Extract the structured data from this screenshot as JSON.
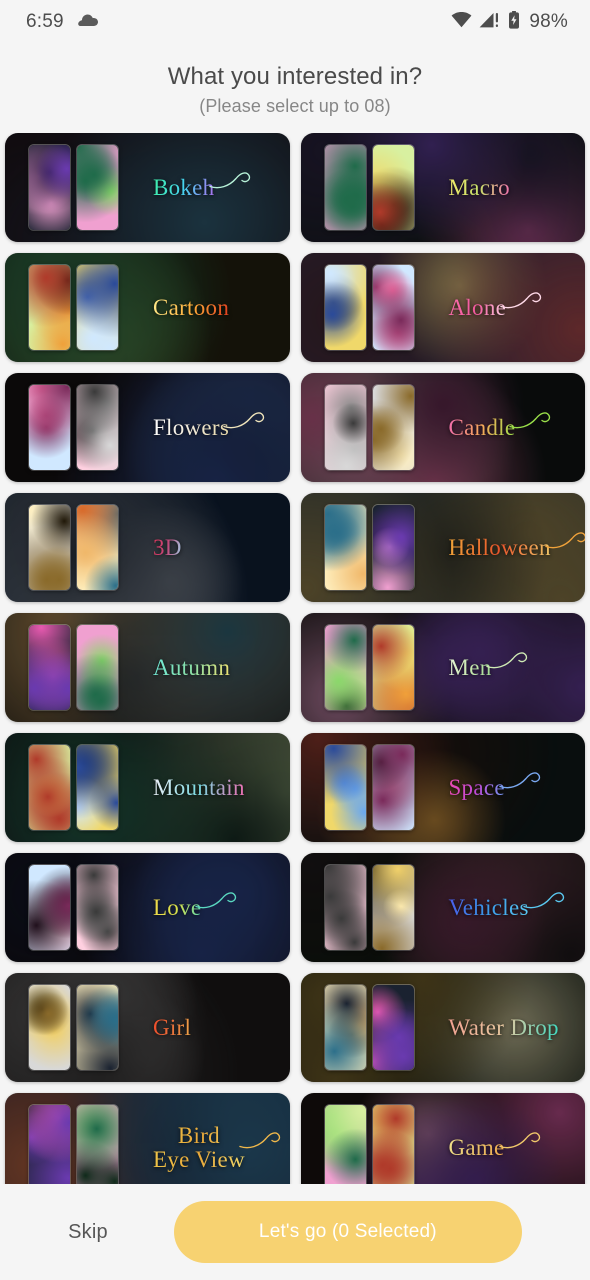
{
  "statusbar": {
    "time": "6:59",
    "battery_percent": "98%",
    "icons": [
      "cloud-icon",
      "wifi-icon",
      "cellular-signal-icon",
      "battery-charging-icon"
    ]
  },
  "header": {
    "title": "What you interested in?",
    "subtitle": "(Please select up to 08)"
  },
  "theme": {
    "page_background": "#f5f5f5",
    "title_color": "#4a4a4a",
    "subtitle_color": "#878787",
    "cta_background": "#f7d271",
    "cta_text_color": "#ffffff",
    "skip_color": "#565656"
  },
  "categories": [
    {
      "label": "Bokeh",
      "card_bg": "#120a0c",
      "grad": [
        "#3ef0a8",
        "#46d2f0",
        "#b06cf0"
      ],
      "swash": true,
      "swash_color": "#b7f2d8"
    },
    {
      "label": "Macro",
      "card_bg": "#0d1211",
      "grad": [
        "#f2e96b",
        "#c8e06a",
        "#f06ab0"
      ],
      "swash": false,
      "swash_color": "#d9e88a"
    },
    {
      "label": "Cartoon",
      "card_bg": "#17140a",
      "grad": [
        "#ffe98a",
        "#ffb03a",
        "#e03c1e"
      ],
      "swash": false,
      "swash_color": "#ffd86a"
    },
    {
      "label": "Alone",
      "card_bg": "#2a2233",
      "grad": [
        "#ff6fae",
        "#f0589d",
        "#ffd9e8"
      ],
      "swash": true,
      "swash_color": "#ffd9e8"
    },
    {
      "label": "Flowers",
      "card_bg": "#0d0a0a",
      "grad": [
        "#ffffff",
        "#f0e9d8",
        "#e8d9a8"
      ],
      "swash": true,
      "swash_color": "#efe4bb"
    },
    {
      "label": "Candle",
      "card_bg": "#0a0d0d",
      "grad": [
        "#f06ab0",
        "#f7a85a",
        "#9ae04a"
      ],
      "swash": true,
      "swash_color": "#9ae04a"
    },
    {
      "label": "3D",
      "card_bg": "#0a1422",
      "grad": [
        "#e0345a",
        "#c0487a",
        "#9fd8f0"
      ],
      "swash": false,
      "swash_color": "#9fd8f0"
    },
    {
      "label": "Halloween",
      "card_bg": "#2a302e",
      "grad": [
        "#f2a83a",
        "#e8542a",
        "#f0c96a"
      ],
      "swash": true,
      "swash_color": "#f0a23a"
    },
    {
      "label": "Autumn",
      "card_bg": "#13120f",
      "grad": [
        "#6ee8d8",
        "#8ae0a8",
        "#f0e070"
      ],
      "swash": false,
      "swash_color": "#8ae0b8"
    },
    {
      "label": "Men",
      "card_bg": "#131111",
      "grad": [
        "#e8f5d8",
        "#c8e8b0",
        "#9ed890"
      ],
      "swash": true,
      "swash_color": "#cfeab4"
    },
    {
      "label": "Mountain",
      "card_bg": "#0f1114",
      "grad": [
        "#f0f0f8",
        "#7ad8e0",
        "#f06ab0"
      ],
      "swash": false,
      "swash_color": "#e8d0e8"
    },
    {
      "label": "Space",
      "card_bg": "#0a1010",
      "grad": [
        "#f04ab0",
        "#c04ad8",
        "#6a9af0"
      ],
      "swash": true,
      "swash_color": "#7aa8f0"
    },
    {
      "label": "Love",
      "card_bg": "#0d0a0d",
      "grad": [
        "#f0d84a",
        "#d8e04a",
        "#5ad8b0"
      ],
      "swash": true,
      "swash_color": "#5ad8c0"
    },
    {
      "label": "Vehicles",
      "card_bg": "#081008",
      "grad": [
        "#4a5ae8",
        "#3a9ae8",
        "#5ac8f0"
      ],
      "swash": true,
      "swash_color": "#5ac8f0"
    },
    {
      "label": "Girl",
      "card_bg": "#121010",
      "grad": [
        "#f04a2a",
        "#e8703a",
        "#f0a84a"
      ],
      "swash": false,
      "swash_color": "#f0803a"
    },
    {
      "label": "Water Drop",
      "card_bg": "#0a100c",
      "grad": [
        "#f0a090",
        "#e8c8a0",
        "#3ad8c0"
      ],
      "swash": false,
      "swash_color": "#3ad8c0"
    },
    {
      "label": "Bird\nEye View",
      "card_bg": "#121424",
      "grad": [
        "#f0c84a",
        "#e8a83a",
        "#f0d86a"
      ],
      "swash": true,
      "swash_color": "#f0b84a"
    },
    {
      "label": "Game",
      "card_bg": "#100c0a",
      "grad": [
        "#f0e08a",
        "#e8c06a",
        "#f0a84a"
      ],
      "swash": true,
      "swash_color": "#f0c86a"
    }
  ],
  "footer": {
    "skip_label": "Skip",
    "cta_label": "Let's go (0 Selected)",
    "selected_count": 0
  }
}
